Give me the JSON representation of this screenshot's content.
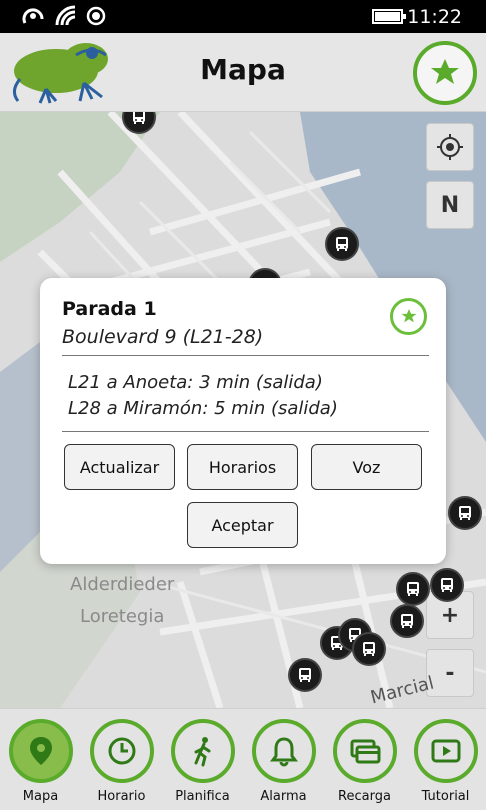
{
  "status_bar": {
    "time": "11:22",
    "icons": [
      "signal-strength-icon",
      "wifi-icon",
      "notification-circle-icon",
      "battery-icon"
    ]
  },
  "header": {
    "title": "Mapa",
    "logo_icon": "frog-logo-icon",
    "favorite_icon": "star-icon"
  },
  "map": {
    "locate_icon": "crosshair-icon",
    "north_label": "N",
    "zoom_in_label": "+",
    "zoom_out_label": "-",
    "place_label_line1": "Alderdieder",
    "place_label_line2": "Loretegia",
    "street_label": "Marcial",
    "stop_icon": "bus-icon"
  },
  "dialog": {
    "title": "Parada 1",
    "subtitle": "Boulevard 9 (L21-28)",
    "favorite_icon": "star-icon",
    "lines": [
      "L21 a Anoeta: 3 min (salida)",
      "L28 a Miramón: 5 min (salida)"
    ],
    "buttons": {
      "refresh": "Actualizar",
      "schedules": "Horarios",
      "voice": "Voz",
      "accept": "Aceptar"
    }
  },
  "bottom_nav": {
    "items": [
      {
        "label": "Mapa",
        "icon": "map-pin-icon",
        "active": true
      },
      {
        "label": "Horario",
        "icon": "clock-icon",
        "active": false
      },
      {
        "label": "Planifica",
        "icon": "walking-person-icon",
        "active": false
      },
      {
        "label": "Alarma",
        "icon": "bell-icon",
        "active": false
      },
      {
        "label": "Recarga",
        "icon": "credit-card-icon",
        "active": false
      },
      {
        "label": "Tutorial",
        "icon": "play-icon",
        "active": false
      }
    ]
  },
  "colors": {
    "accent_green": "#5aab2b",
    "active_nav_fill": "#88bd4c",
    "water": "#a9b8c8",
    "park": "#c7d3c2"
  }
}
